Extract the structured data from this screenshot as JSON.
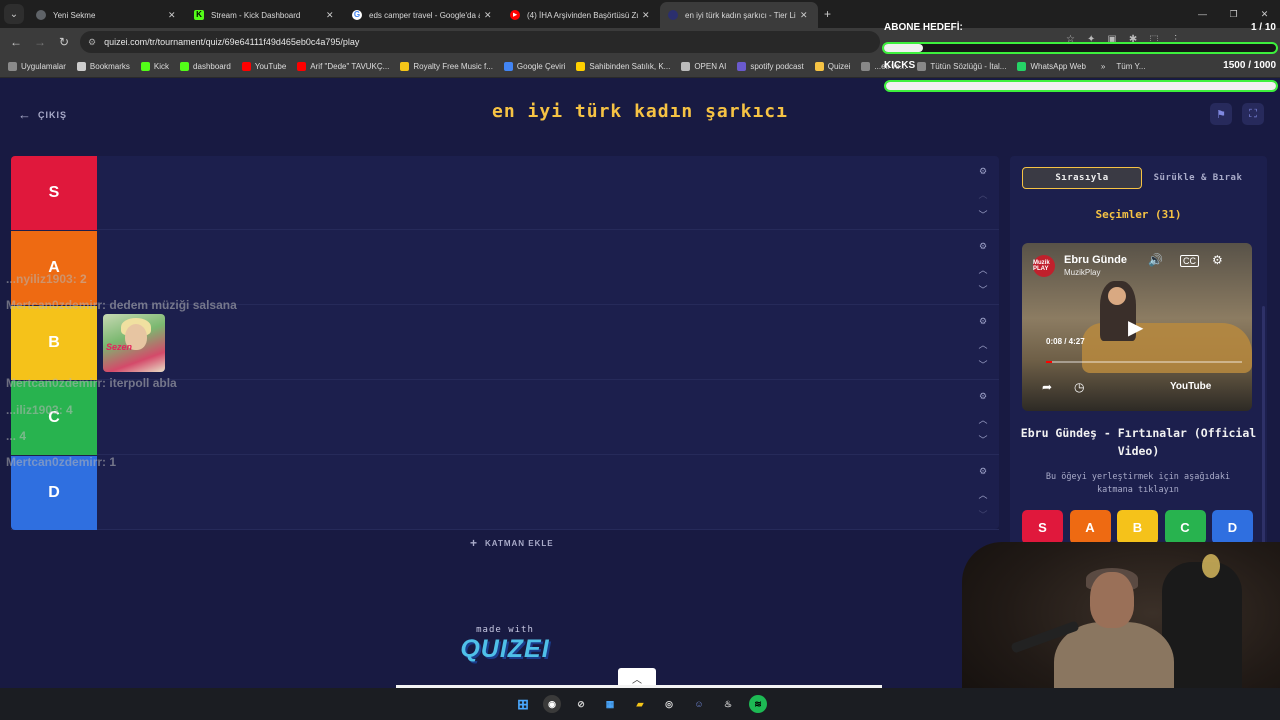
{
  "browser": {
    "tabs": [
      {
        "title": "Yeni Sekme",
        "color": "#5f6368",
        "glyph": ""
      },
      {
        "title": "Stream - Kick Dashboard",
        "color": "#53fc18",
        "glyph": "K"
      },
      {
        "title": "eds camper travel - Google'da ara",
        "color": "#4285f4",
        "glyph": "G"
      },
      {
        "title": "(4) İHA Arşivinden Başörtüsü Zu...",
        "color": "#ff0000",
        "glyph": "▶"
      },
      {
        "title": "en iyi türk kadın şarkıcı - Tier Li",
        "color": "#2b2f6e",
        "glyph": "Q"
      }
    ],
    "url": "quizei.com/tr/tournament/quiz/69e64111f49d465eb0c4a795/play",
    "bookmarks": [
      {
        "label": "Uygulamalar",
        "color": "#8a8a8a"
      },
      {
        "label": "Bookmarks",
        "color": "#cccccc"
      },
      {
        "label": "Kick",
        "color": "#53fc18"
      },
      {
        "label": "dashboard",
        "color": "#53fc18"
      },
      {
        "label": "YouTube",
        "color": "#ff0000"
      },
      {
        "label": "Arif \"Dede\" TAVUKÇ...",
        "color": "#ff0000"
      },
      {
        "label": "Royalty Free Music f...",
        "color": "#f5c518"
      },
      {
        "label": "Google Çeviri",
        "color": "#4285f4"
      },
      {
        "label": "Sahibinden Satılık, K...",
        "color": "#ffd000"
      },
      {
        "label": "OPEN AI",
        "color": "#bbbbbb"
      },
      {
        "label": "spotify podcast",
        "color": "#6a5acd"
      },
      {
        "label": "Quizei",
        "color": "#f6c344"
      },
      {
        "label": "...eli ve...",
        "color": "#888888"
      },
      {
        "label": "Tütün Sözlüğü - İtal...",
        "color": "#888888"
      },
      {
        "label": "WhatsApp Web",
        "color": "#25d366"
      }
    ],
    "bookmarks_more": "»",
    "bookmarks_folder": "Tüm Y..."
  },
  "overlay": {
    "sub_goal_label": "ABONE HEDEFİ:",
    "sub_goal_count": "1 / 10",
    "sub_goal_progress": 0.1,
    "kicks_label": "KICKS",
    "kicks_count": "1500 / 1000",
    "kicks_progress": 1.0
  },
  "app": {
    "exit_label": "ÇIKIŞ",
    "title": "en iyi türk kadın şarkıcı",
    "tiers": [
      {
        "label": "S",
        "color": "#e0183c"
      },
      {
        "label": "A",
        "color": "#ee6a12"
      },
      {
        "label": "B",
        "color": "#f5c21a"
      },
      {
        "label": "C",
        "color": "#28b34f"
      },
      {
        "label": "D",
        "color": "#2f6fe0"
      }
    ],
    "tier_b_item_text": "Sezen",
    "add_tier_label": "KATMAN EKLE",
    "made_with": "made with",
    "logo": "QUIZEI"
  },
  "panel": {
    "mode_ordered": "Sırasıyla",
    "mode_drag": "Sürükle & Bırak",
    "choices_title": "Seçimler (31)",
    "video": {
      "title": "Ebru Günde",
      "channel": "MuzikPlay",
      "logo": "Muzik PLAY",
      "time": "0:08 / 4:27",
      "progress": 0.03,
      "brand": "YouTube"
    },
    "item_name": "Ebru Gündeş - Fırtınalar (Official Video)",
    "hint": "Bu öğeyi yerleştirmek için aşağıdaki katmana tıklayın",
    "pick_buttons": [
      "S",
      "A",
      "B",
      "C",
      "D"
    ]
  },
  "chat": [
    {
      "user": "...nyiliz1903:",
      "msg": "2"
    },
    {
      "user": "Mertcan0zdemirr:",
      "msg": "dedem müziği salsana"
    },
    {
      "user": "Mertcan0zdemirr:",
      "msg": "iterpoll abla"
    },
    {
      "user": "...iliz1903:",
      "msg": "4"
    },
    {
      "user": "...",
      "msg": "4"
    },
    {
      "user": "Mertcan0zdemirr:",
      "msg": "1"
    }
  ]
}
